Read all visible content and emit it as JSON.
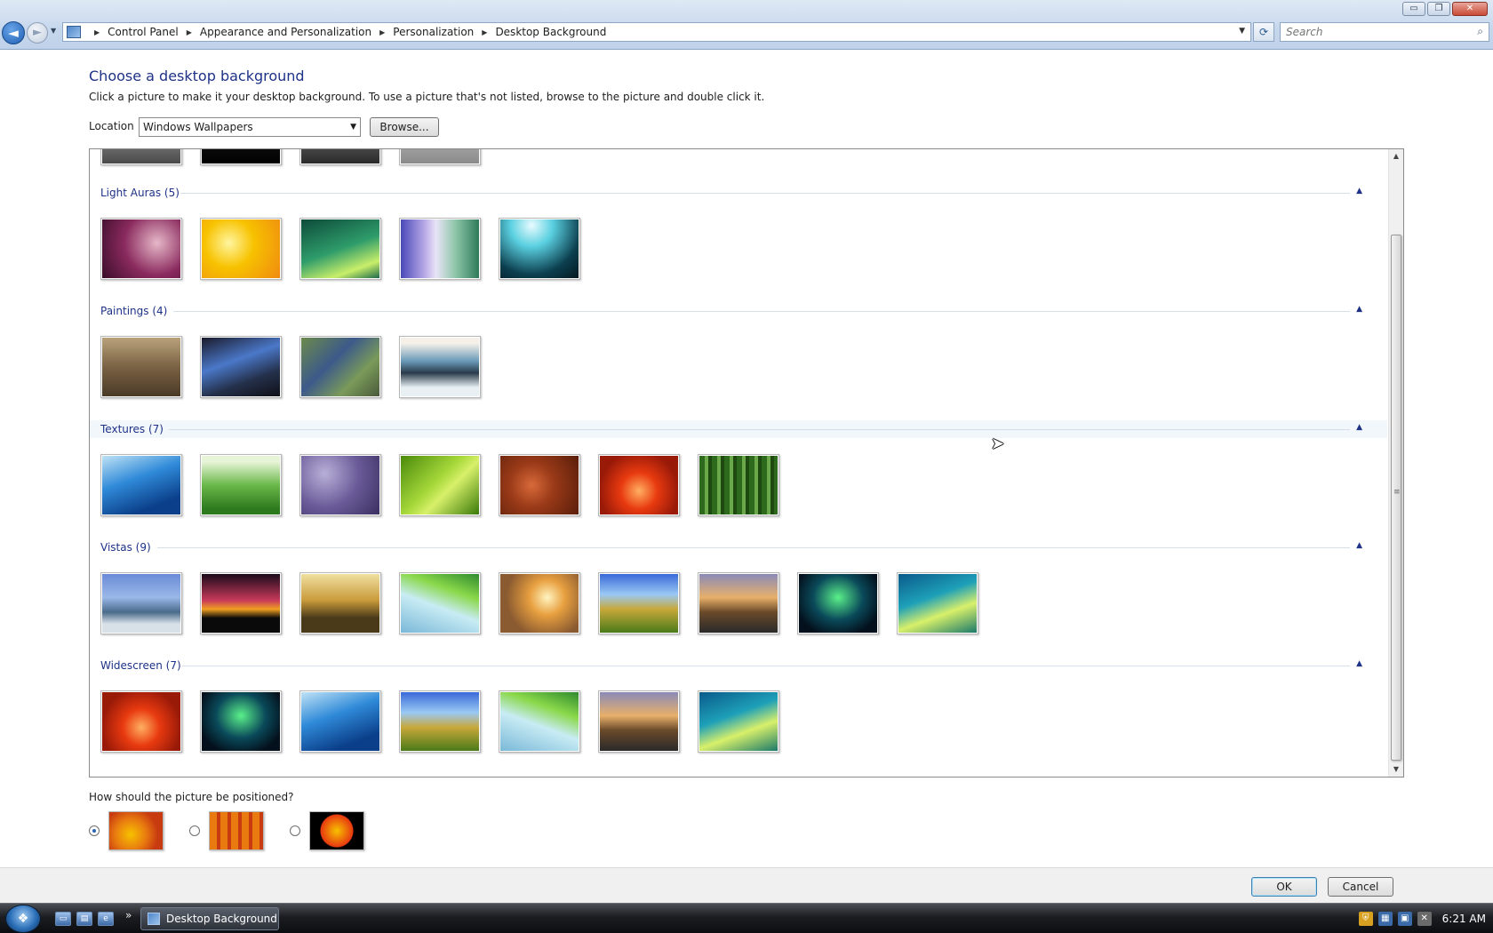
{
  "window": {
    "controls": {
      "minimize": "▭",
      "maximize": "❐",
      "close": "✕"
    }
  },
  "address_bar": {
    "breadcrumbs": [
      "Control Panel",
      "Appearance and Personalization",
      "Personalization",
      "Desktop Background"
    ],
    "search_placeholder": "Search"
  },
  "page": {
    "title": "Choose a desktop background",
    "description": "Click a picture to make it your desktop background. To use a picture that's not listed, browse to the picture and double click it."
  },
  "location": {
    "label": "Location",
    "selected": "Windows Wallpapers",
    "browse_label": "Browse..."
  },
  "gallery": {
    "groups": [
      {
        "title": "Light Auras (5)",
        "thumbnails": [
          "radial-gradient(circle at 70% 40%, #e6b8c8, #8a2a5e 50%, #3a0d2a)",
          "radial-gradient(circle at 35% 40%, #fff6a0, #f7c200 40%, #f08a10)",
          "linear-gradient(160deg, #0d4b3a, #2e9c6a 50%, #c9ef6a 80%, #1d6a4a)",
          "linear-gradient(90deg, #4a4ab8, #b6a7e6 30%, #e8e4f6 45%, #8dc6a8 70%, #2e7a5a)",
          "radial-gradient(circle at 40% 10%, #e9fbff, #5ad0e0 30%, #0c3f4f 70%, #031820)"
        ]
      },
      {
        "title": "Paintings (4)",
        "thumbnails": [
          "linear-gradient(180deg, #b9a27a, #7a6244 50%, #4a3a26)",
          "linear-gradient(160deg, #1a1a2a, #4a78c8 40%, #24304a 70%, #101018)",
          "linear-gradient(135deg, #6c8a4a, #3c5a8a 40%, #7a9a5a 70%, #4a5a3a)",
          "linear-gradient(180deg, #f4f0e8 10%, #6a9ab8 40%, #2a3a4a 60%, #e8f0f4 85%)"
        ]
      },
      {
        "title": "Textures (7)",
        "thumbnails": [
          "linear-gradient(160deg, #bfe2f6, #2f8ad8 40%, #0b3f8a 80%)",
          "linear-gradient(180deg, #e8f4d8 10%, #6ab84a 50%, #2e7a1e 90%)",
          "radial-gradient(circle at 30% 30%, #b8b0d8, #6a5a98 50%, #3a3060)",
          "linear-gradient(135deg, #4a8a0a, #a6d83a 45%, #d8f06a 60%, #3a7a0a)",
          "radial-gradient(circle at 40% 50%, #d86a3a, #9a3a18 40%, #5a1e0a)",
          "radial-gradient(circle at 50% 60%, #ffb060, #e83a10 35%, #9a1a08 75%)",
          "repeating-linear-gradient(90deg, #2e6a1e 0 6px, #6aa84a 6px 10px, #1e4a12 10px 14px)"
        ]
      },
      {
        "title": "Vistas (9)",
        "thumbnails": [
          "linear-gradient(180deg, #6a8ad8, #9ab8e8 40%, #4a6a8a 65%, #d8e0e8 85%)",
          "linear-gradient(180deg, #1a0a1a, #c83a5a 45%, #f0a020 60%, #0a0a0a 75%)",
          "linear-gradient(180deg, #f0e0a0, #c89a3a 45%, #4a3a1a 75%)",
          "linear-gradient(200deg, #2e8a2e, #8ad84a 30%, #c8ecf4 55%, #7ab8d8)",
          "radial-gradient(circle at 60% 40%, #fff4c0, #e8a040 30%, #8a5a30 70%)",
          "linear-gradient(180deg, #3a6ad8, #9ac8f4 35%, #c8a83a 60%, #4a7a1a)",
          "linear-gradient(180deg, #8a8ab8, #e8b06a 40%, #6a4a2a 65%, #2a2a2a)",
          "radial-gradient(ellipse at 50% 40%, #5af08a, #0a4a5a 45%, #04101c 80%)",
          "linear-gradient(160deg, #0a5a8a, #1ea0b8 40%, #d8f06a 65%, #1a7a6a)"
        ]
      },
      {
        "title": "Widescreen (7)",
        "thumbnails": [
          "radial-gradient(circle at 50% 60%, #ffb060, #e83a10 35%, #9a1a08 75%)",
          "radial-gradient(ellipse at 50% 40%, #5af08a, #0a4a5a 45%, #04101c 80%)",
          "linear-gradient(160deg, #bfe2f6, #2f8ad8 40%, #0b3f8a 80%)",
          "linear-gradient(180deg, #3a6ad8, #9ac8f4 35%, #c8a83a 60%, #4a7a1a)",
          "linear-gradient(200deg, #2e8a2e, #8ad84a 30%, #c8ecf4 55%, #7ab8d8)",
          "linear-gradient(180deg, #8a8ab8, #e8b06a 40%, #6a4a2a 65%, #2a2a2a)",
          "linear-gradient(160deg, #0a5a8a, #1ea0b8 40%, #d8f06a 65%, #1a7a6a)"
        ]
      }
    ],
    "partial_row_thumbnails": [
      "linear-gradient(180deg, #c0c0c0, #4a4a4a)",
      "linear-gradient(180deg, #2a2a2a, #000000)",
      "linear-gradient(180deg, #9a9a9a, #2a2a2a)",
      "linear-gradient(180deg, #d8d8d8, #8a8a8a)"
    ],
    "collapse_glyph": "▲",
    "scroll_up_glyph": "▲",
    "scroll_down_glyph": "▼"
  },
  "positioning": {
    "label": "How should the picture be positioned?",
    "selected_index": 0,
    "options": [
      {
        "name": "fit-to-screen",
        "preview": "radial-gradient(circle at 40% 60%, #f7c200, #e87a10 40%, #c83a10 70%)"
      },
      {
        "name": "tile",
        "preview": "repeating-linear-gradient(90deg, #e87a10 0 8px, #c83a10 8px 12px), repeating-linear-gradient(0deg, #f7c200 0 6px, #8a3a08 6px 9px)"
      },
      {
        "name": "center",
        "preview": "radial-gradient(circle at 50% 50%, #f7c200 0, #e83a10 18px, #000 19px)"
      }
    ]
  },
  "footer": {
    "ok_label": "OK",
    "cancel_label": "Cancel"
  },
  "taskbar": {
    "start_glyph": "❖",
    "quick_launch_more": "»",
    "active_window": "Desktop Background",
    "clock": "6:21 AM"
  },
  "colors": {
    "link_blue": "#1e3287",
    "address_bg": "#c6d7ec",
    "taskbar": "#1b1d21"
  }
}
